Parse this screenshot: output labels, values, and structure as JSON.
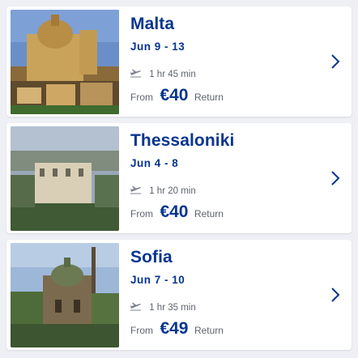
{
  "destinations": [
    {
      "city": "Malta",
      "dates": "Jun 9 - 13",
      "duration": "1 hr 45 min",
      "from_label": "From",
      "price": "€40",
      "trip_type": "Return",
      "photo": "malta-cathedral-photo"
    },
    {
      "city": "Thessaloniki",
      "dates": "Jun 4 - 8",
      "duration": "1 hr 20 min",
      "from_label": "From",
      "price": "€40",
      "trip_type": "Return",
      "photo": "thessaloniki-tower-photo"
    },
    {
      "city": "Sofia",
      "dates": "Jun 7 - 10",
      "duration": "1 hr 35 min",
      "from_label": "From",
      "price": "€49",
      "trip_type": "Return",
      "photo": "sofia-church-photo"
    }
  ],
  "colors": {
    "brand_navy": "#073590",
    "secondary_text": "#5f6470",
    "background": "#eef0f5"
  },
  "icons": {
    "flight": "plane-icon",
    "open": "chevron-right-icon"
  }
}
